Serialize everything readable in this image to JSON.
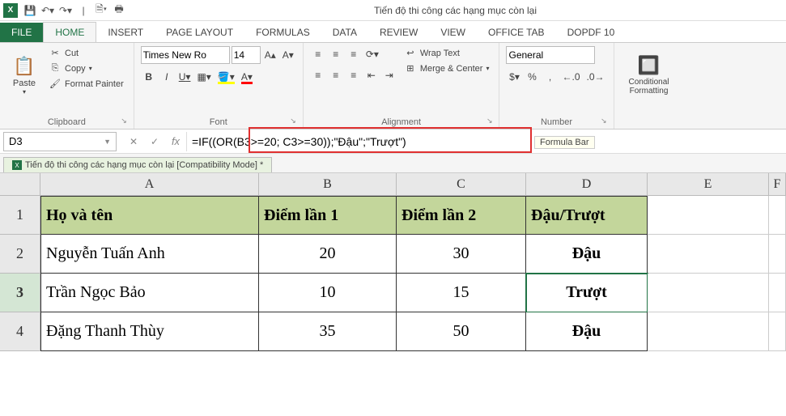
{
  "app": {
    "title": "Tiến độ thi công các hạng mục còn lại"
  },
  "qat": {
    "save": "💾",
    "undo": "↶",
    "redo": "↷",
    "new": "",
    "print": ""
  },
  "tabs": {
    "file": "FILE",
    "home": "HOME",
    "insert": "INSERT",
    "pagelayout": "PAGE LAYOUT",
    "formulas": "FORMULAS",
    "data": "DATA",
    "review": "REVIEW",
    "view": "VIEW",
    "officetab": "OFFICE TAB",
    "dopdf": "doPDF 10"
  },
  "ribbon": {
    "clipboard": {
      "label": "Clipboard",
      "paste": "Paste",
      "cut": "Cut",
      "copy": "Copy",
      "formatpainter": "Format Painter"
    },
    "font": {
      "label": "Font",
      "name": "Times New Ro",
      "size": "14",
      "bold": "B",
      "italic": "I",
      "underline": "U"
    },
    "alignment": {
      "label": "Alignment",
      "wrap": "Wrap Text",
      "merge": "Merge & Center"
    },
    "number": {
      "label": "Number",
      "format": "General",
      "currency": "$",
      "percent": "%",
      "comma": ",",
      "incdec": ".00",
      "decdec": ".00"
    },
    "styles": {
      "cond": "Conditional Formatting"
    }
  },
  "formula": {
    "cell": "D3",
    "value": "=IF((OR(B3>=20; C3>=30));\"Đậu\";\"Trượt\")",
    "tooltip": "Formula Bar"
  },
  "doctab": {
    "label": "Tiến độ thi công các hạng mục còn lại  [Compatibility Mode] *"
  },
  "cols": [
    "A",
    "B",
    "C",
    "D",
    "E",
    "F"
  ],
  "rows": [
    "1",
    "2",
    "3",
    "4"
  ],
  "table": {
    "headers": {
      "name": "Họ và tên",
      "s1": "Điểm lần 1",
      "s2": "Điểm lần 2",
      "res": "Đậu/Trượt"
    },
    "data": [
      {
        "name": "Nguyễn Tuấn Anh",
        "s1": "20",
        "s2": "30",
        "res": "Đậu"
      },
      {
        "name": "Trần Ngọc Bảo",
        "s1": "10",
        "s2": "15",
        "res": "Trượt"
      },
      {
        "name": "Đặng Thanh Thùy",
        "s1": "35",
        "s2": "50",
        "res": "Đậu"
      }
    ]
  }
}
